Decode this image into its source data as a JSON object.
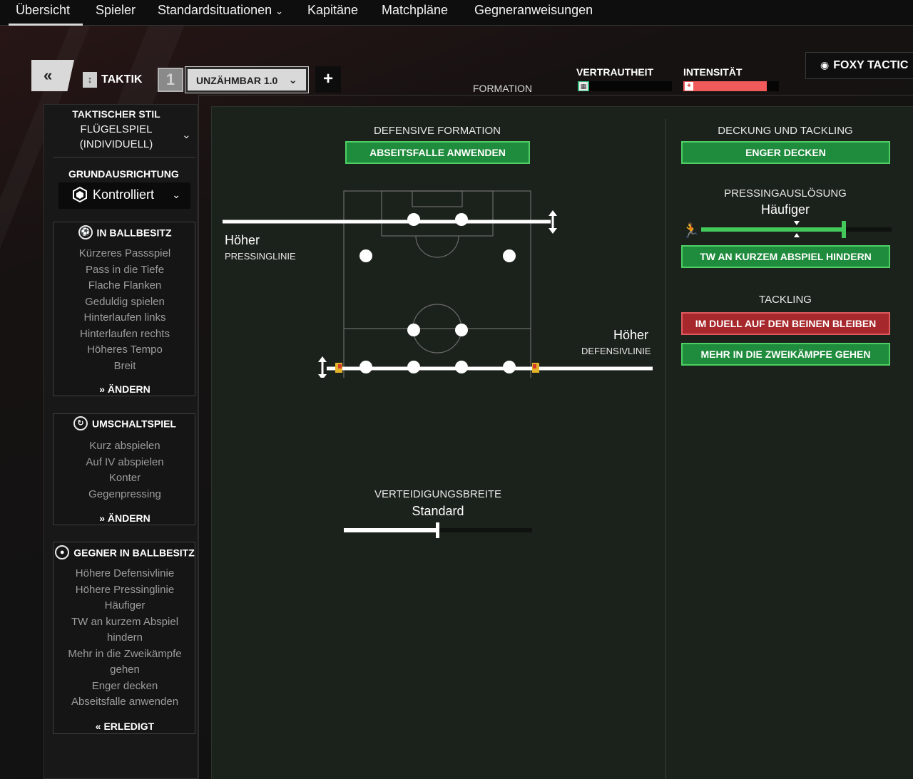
{
  "nav": {
    "items": [
      "Übersicht",
      "Spieler",
      "Standardsituationen",
      "Kapitäne",
      "Matchpläne",
      "Gegneranweisungen"
    ],
    "dropdown_item_index": 2
  },
  "toolbar": {
    "back_icon": "double-chevron-left-icon",
    "taktik_label": "TAKTIK",
    "slot_number": "1",
    "tactic_name": "UNZÄHMBAR 1.0",
    "add_icon": "plus-icon",
    "formation_label": "FORMATION",
    "vertrautheit_label": "VERTRAUTHEIT",
    "vertrautheit_level": 0.12,
    "intensitaet_label": "INTENSITÄT",
    "intensitaet_level": 0.87,
    "view_label": "FOXY TACTIC"
  },
  "sidebar": {
    "style_line1": "TAKTISCHER STIL",
    "style_line2": "FLÜGELSPIEL",
    "style_line3": "(INDIVIDUELL)",
    "grund_label": "GRUNDAUSRICHTUNG",
    "grund_value": "Kontrolliert",
    "ballbesitz": {
      "title": "IN BALLBESITZ",
      "items": [
        "Kürzeres Passspiel",
        "Pass in die Tiefe",
        "Flache Flanken",
        "Geduldig spielen",
        "Hinterlaufen links",
        "Hinterlaufen rechts",
        "Höheres Tempo",
        "Breit"
      ],
      "action": "ÄNDERN"
    },
    "umschalt": {
      "title": "UMSCHALTSPIEL",
      "items": [
        "Kurz abspielen",
        "Auf IV abspielen",
        "Konter",
        "Gegenpressing"
      ],
      "action": "ÄNDERN"
    },
    "gegner": {
      "title": "GEGNER IN BALLBESITZ",
      "items": [
        "Höhere Defensivlinie",
        "Höhere Pressinglinie",
        "Häufiger",
        "TW an kurzem Abspiel",
        "hindern",
        "Mehr in die Zweikämpfe",
        "gehen",
        "Enger decken",
        "Abseitsfalle anwenden"
      ],
      "action": "ERLEDIGT"
    }
  },
  "defense": {
    "title": "DEFENSIVE FORMATION",
    "offside_button": "ABSEITSFALLE ANWENDEN",
    "press_value": "Höher",
    "press_label": "PRESSINGLINIE",
    "def_value": "Höher",
    "def_label": "DEFENSIVLINIE",
    "width_title": "VERTEIDIGUNGSBREITE",
    "width_value": "Standard",
    "width_level": 0.5
  },
  "marking": {
    "title": "DECKUNG UND TACKLING",
    "tight_button": "ENGER DECKEN",
    "trigger_title": "PRESSINGAUSLÖSUNG",
    "trigger_value": "Häufiger",
    "trigger_level": 0.75,
    "gk_button": "TW AN KURZEM ABSPIEL HINDERN",
    "tackling_title": "TACKLING",
    "stay_button": "IM DUELL AUF DEN BEINEN BLEIBEN",
    "more_button": "MEHR IN DIE ZWEIKÄMPFE GEHEN"
  },
  "colors": {
    "accent_green": "#1f8b3c",
    "accent_red": "#a6282c",
    "vertrautheit": "#35c07e",
    "intensitaet": "#f05a5a",
    "goalkeeper": "#4a1a8a"
  }
}
